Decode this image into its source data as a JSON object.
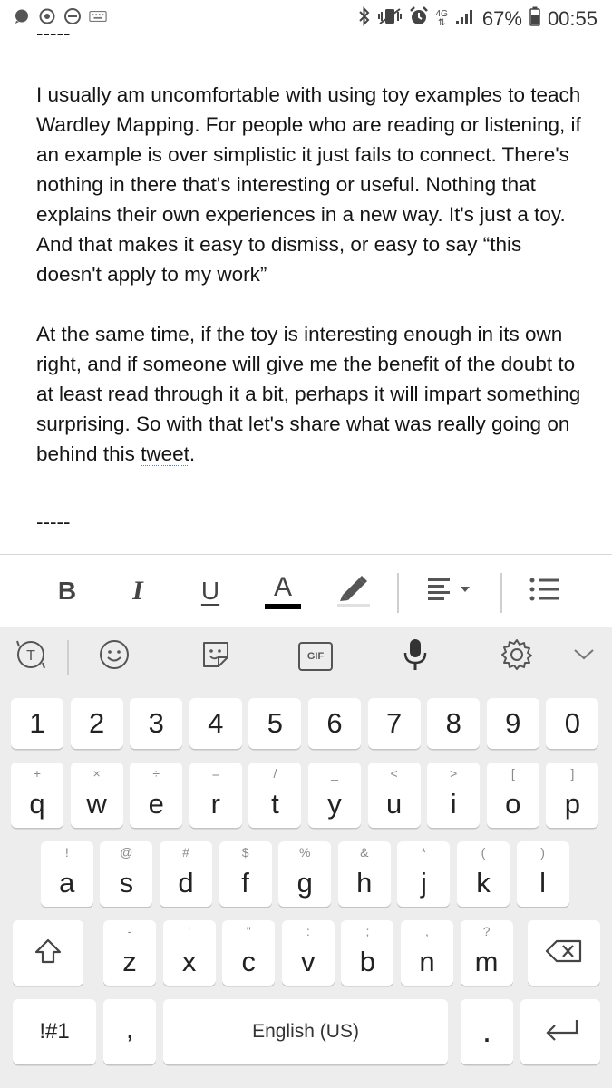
{
  "status_bar": {
    "net": "4G",
    "battery": "67%",
    "time": "00:55"
  },
  "document": {
    "divider_top": "-----",
    "para1": "I usually am uncomfortable with using toy examples to teach Wardley Mapping. For people who are reading or listening, if an example is over simplistic it just fails to connect. There's nothing in there that's interesting or useful. Nothing that explains their own experiences in a new way. It's just a toy. And that makes it easy to dismiss, or easy to say “this doesn't apply to my work”",
    "para2_before": "At the same time, if the toy is interesting enough in its own right, and if someone will give me the benefit of the doubt to at least read through it a bit, perhaps it will impart something surprising. So with that let's share what was really going on behind this ",
    "para2_link": "tweet",
    "para2_after": ".",
    "divider_bottom": "-----"
  },
  "format_toolbar": {
    "bold": "B",
    "italic": "I",
    "underline": "U",
    "text_color": "A",
    "text_color_value": "#000000"
  },
  "keyboard": {
    "number_row": [
      "1",
      "2",
      "3",
      "4",
      "5",
      "6",
      "7",
      "8",
      "9",
      "0"
    ],
    "row1": [
      {
        "k": "q",
        "s": "+"
      },
      {
        "k": "w",
        "s": "×"
      },
      {
        "k": "e",
        "s": "÷"
      },
      {
        "k": "r",
        "s": "="
      },
      {
        "k": "t",
        "s": "/"
      },
      {
        "k": "y",
        "s": "_"
      },
      {
        "k": "u",
        "s": "<"
      },
      {
        "k": "i",
        "s": ">"
      },
      {
        "k": "o",
        "s": "["
      },
      {
        "k": "p",
        "s": "]"
      }
    ],
    "row2": [
      {
        "k": "a",
        "s": "!"
      },
      {
        "k": "s",
        "s": "@"
      },
      {
        "k": "d",
        "s": "#"
      },
      {
        "k": "f",
        "s": "$"
      },
      {
        "k": "g",
        "s": "%"
      },
      {
        "k": "h",
        "s": "&"
      },
      {
        "k": "j",
        "s": "*"
      },
      {
        "k": "k",
        "s": "("
      },
      {
        "k": "l",
        "s": ")"
      }
    ],
    "row3": [
      {
        "k": "z",
        "s": "-"
      },
      {
        "k": "x",
        "s": "'"
      },
      {
        "k": "c",
        "s": "\""
      },
      {
        "k": "v",
        "s": ":"
      },
      {
        "k": "b",
        "s": ";"
      },
      {
        "k": "n",
        "s": ","
      },
      {
        "k": "m",
        "s": "?"
      }
    ],
    "symbols_label": "!#1",
    "comma": ",",
    "space_label": "English (US)",
    "period": ".",
    "gif_label": "GIF"
  },
  "colors": {
    "keyboard_bg": "#ededed",
    "key_bg": "#ffffff",
    "link_underline": "#6b7fa8"
  }
}
